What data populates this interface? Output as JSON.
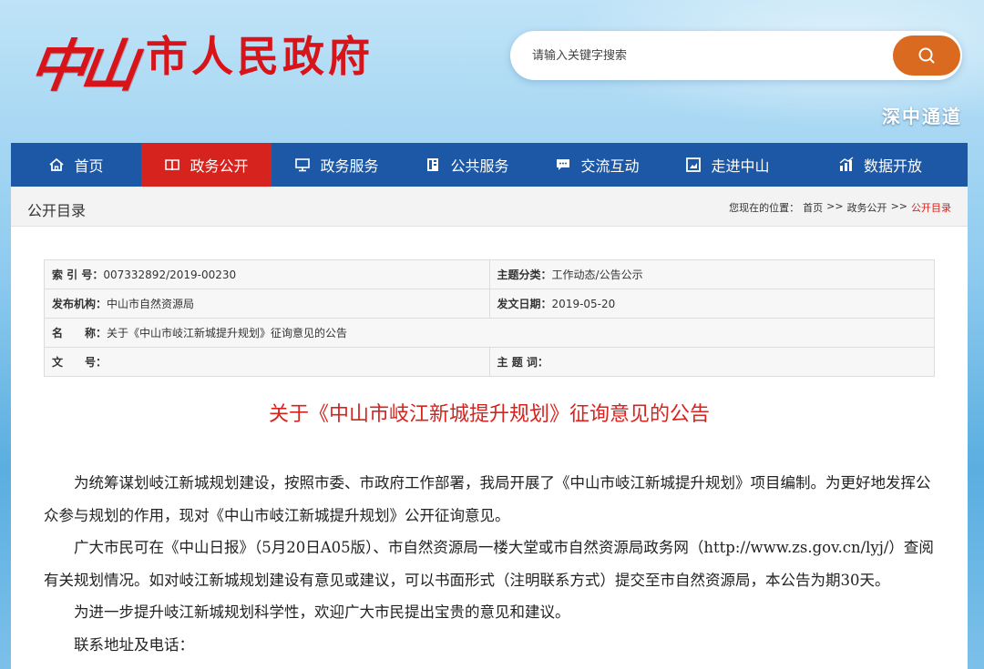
{
  "header": {
    "logo_city": "中山",
    "logo_gov": "市人民政府",
    "search_placeholder": "请输入关键字搜索",
    "quick_link": "深中通道"
  },
  "nav": [
    {
      "label": "首页",
      "icon": "home-icon"
    },
    {
      "label": "政务公开",
      "icon": "book-icon",
      "active": true
    },
    {
      "label": "政务服务",
      "icon": "monitor-icon"
    },
    {
      "label": "公共服务",
      "icon": "document-icon"
    },
    {
      "label": "交流互动",
      "icon": "chat-icon"
    },
    {
      "label": "走进中山",
      "icon": "picture-icon"
    },
    {
      "label": "数据开放",
      "icon": "bar-chart-icon"
    }
  ],
  "subbar": {
    "title": "公开目录",
    "location_label": "您现在的位置：",
    "crumbs": [
      "首页",
      ">>",
      "政务公开",
      ">>",
      "公开目录"
    ]
  },
  "meta": {
    "index_key": "索 引 号：",
    "index_val": "007332892/2019-00230",
    "topic_key": "主题分类：",
    "topic_val": "工作动态/公告公示",
    "org_key": "发布机构：",
    "org_val": "中山市自然资源局",
    "date_key": "发文日期：",
    "date_val": "2019-05-20",
    "name_key": "名　　称：",
    "name_val": "关于《中山市岐江新城提升规划》征询意见的公告",
    "docno_key": "文　　号：",
    "docno_val": "",
    "keywords_key": "主 题 词：",
    "keywords_val": ""
  },
  "article": {
    "title": "关于《中山市岐江新城提升规划》征询意见的公告",
    "p1": "为统筹谋划岐江新城规划建设，按照市委、市政府工作部署，我局开展了《中山市岐江新城提升规划》项目编制。为更好地发挥公众参与规划的作用，现对《中山市岐江新城提升规划》公开征询意见。",
    "p2": "广大市民可在《中山日报》（5月20日A05版）、市自然资源局一楼大堂或市自然资源局政务网（http://www.zs.gov.cn/lyj/）查阅有关规划情况。如对岐江新城规划建设有意见或建议，可以书面形式（注明联系方式）提交至市自然资源局，本公告为期30天。",
    "p3": "为进一步提升岐江新城规划科学性，欢迎广大市民提出宝贵的意见和建议。",
    "p4": "联系地址及电话："
  }
}
